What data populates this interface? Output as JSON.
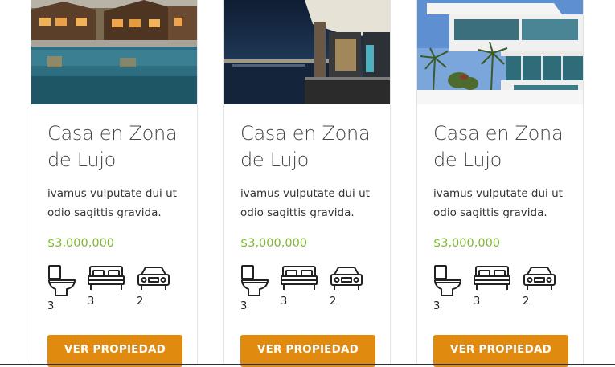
{
  "listings": [
    {
      "title": "Casa en Zona de Lujo",
      "description": "ivamus vulputate dui ut odio sagittis gravida.",
      "price": "$3,000,000",
      "bathrooms": "3",
      "bedrooms": "3",
      "parking": "2",
      "button_label": "VER PROPIEDAD"
    },
    {
      "title": "Casa en Zona de Lujo",
      "description": "ivamus vulputate dui ut odio sagittis gravida.",
      "price": "$3,000,000",
      "bathrooms": "3",
      "bedrooms": "3",
      "parking": "2",
      "button_label": "VER PROPIEDAD"
    },
    {
      "title": "Casa en Zona de Lujo",
      "description": "ivamus vulputate dui ut odio sagittis gravida.",
      "price": "$3,000,000",
      "bathrooms": "3",
      "bedrooms": "3",
      "parking": "2",
      "button_label": "VER PROPIEDAD"
    }
  ],
  "icons": {
    "bathroom": "toilet-icon",
    "bedroom": "bed-icon",
    "parking": "car-icon"
  },
  "colors": {
    "price": "#7cb82f",
    "button": "#e08a10",
    "button_text": "#ffffff"
  }
}
